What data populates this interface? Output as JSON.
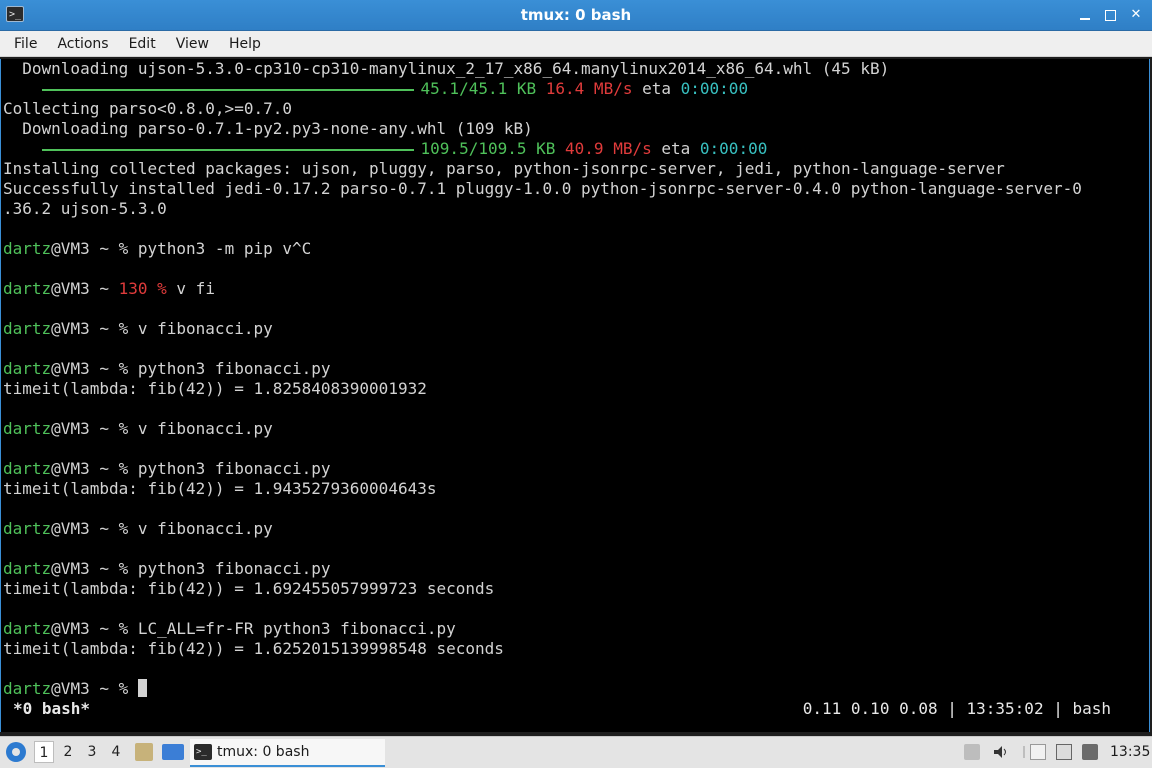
{
  "window": {
    "title": "tmux: 0 bash"
  },
  "menu": [
    "File",
    "Actions",
    "Edit",
    "View",
    "Help"
  ],
  "terminal": {
    "lines": [
      [
        {
          "t": "  Downloading ujson-5.3.0-cp310-cp310-manylinux_2_17_x86_64.manylinux2014_x86_64.whl (45 kB)"
        }
      ],
      [
        {
          "t": "    ",
          "bar": true
        },
        {
          "t": "45.1/45.1 KB",
          "c": "green"
        },
        {
          "t": " "
        },
        {
          "t": "16.4 MB/s",
          "c": "red"
        },
        {
          "t": " eta "
        },
        {
          "t": "0:00:00",
          "c": "cyan"
        }
      ],
      [
        {
          "t": "Collecting parso<0.8.0,>=0.7.0"
        }
      ],
      [
        {
          "t": "  Downloading parso-0.7.1-py2.py3-none-any.whl (109 kB)"
        }
      ],
      [
        {
          "t": "    ",
          "bar": true
        },
        {
          "t": "109.5/109.5 KB",
          "c": "green"
        },
        {
          "t": " "
        },
        {
          "t": "40.9 MB/s",
          "c": "red"
        },
        {
          "t": " eta "
        },
        {
          "t": "0:00:00",
          "c": "cyan"
        }
      ],
      [
        {
          "t": "Installing collected packages: ujson, pluggy, parso, python-jsonrpc-server, jedi, python-language-server"
        }
      ],
      [
        {
          "t": "Successfully installed jedi-0.17.2 parso-0.7.1 pluggy-1.0.0 python-jsonrpc-server-0.4.0 python-language-server-0"
        }
      ],
      [
        {
          "t": ".36.2 ujson-5.3.0"
        }
      ],
      [],
      [
        {
          "t": "dartz",
          "c": "user"
        },
        {
          "t": "@VM3 ~ % python3 -m pip v^C"
        }
      ],
      [],
      [
        {
          "t": "dartz",
          "c": "user"
        },
        {
          "t": "@VM3 ~ "
        },
        {
          "t": "130 %",
          "c": "red"
        },
        {
          "t": " v fi"
        }
      ],
      [],
      [
        {
          "t": "dartz",
          "c": "user"
        },
        {
          "t": "@VM3 ~ % v fibonacci.py"
        }
      ],
      [],
      [
        {
          "t": "dartz",
          "c": "user"
        },
        {
          "t": "@VM3 ~ % python3 fibonacci.py"
        }
      ],
      [
        {
          "t": "timeit(lambda: fib(42)) = 1.8258408390001932"
        }
      ],
      [],
      [
        {
          "t": "dartz",
          "c": "user"
        },
        {
          "t": "@VM3 ~ % v fibonacci.py"
        }
      ],
      [],
      [
        {
          "t": "dartz",
          "c": "user"
        },
        {
          "t": "@VM3 ~ % python3 fibonacci.py"
        }
      ],
      [
        {
          "t": "timeit(lambda: fib(42)) = 1.9435279360004643s"
        }
      ],
      [],
      [
        {
          "t": "dartz",
          "c": "user"
        },
        {
          "t": "@VM3 ~ % v fibonacci.py"
        }
      ],
      [],
      [
        {
          "t": "dartz",
          "c": "user"
        },
        {
          "t": "@VM3 ~ % python3 fibonacci.py"
        }
      ],
      [
        {
          "t": "timeit(lambda: fib(42)) = 1.692455057999723 seconds"
        }
      ],
      [],
      [
        {
          "t": "dartz",
          "c": "user"
        },
        {
          "t": "@VM3 ~ % LC_ALL=fr-FR python3 fibonacci.py"
        }
      ],
      [
        {
          "t": "timeit(lambda: fib(42)) = 1.6252015139998548 seconds"
        }
      ],
      [],
      [
        {
          "t": "dartz",
          "c": "user"
        },
        {
          "t": "@VM3 ~ % "
        },
        {
          "cursor": true
        }
      ]
    ]
  },
  "tmux_status": {
    "window": "*0 bash*",
    "right": "0.11 0.10 0.08 | 13:35:02 | bash"
  },
  "taskbar": {
    "desktops": [
      "1",
      "2",
      "3",
      "4"
    ],
    "task_label": "tmux: 0 bash",
    "clock": "13:35"
  },
  "colors": {
    "accent": "#3a8fd6",
    "green": "#4fc15a",
    "red": "#e03b3b",
    "cyan": "#38c1c1"
  }
}
